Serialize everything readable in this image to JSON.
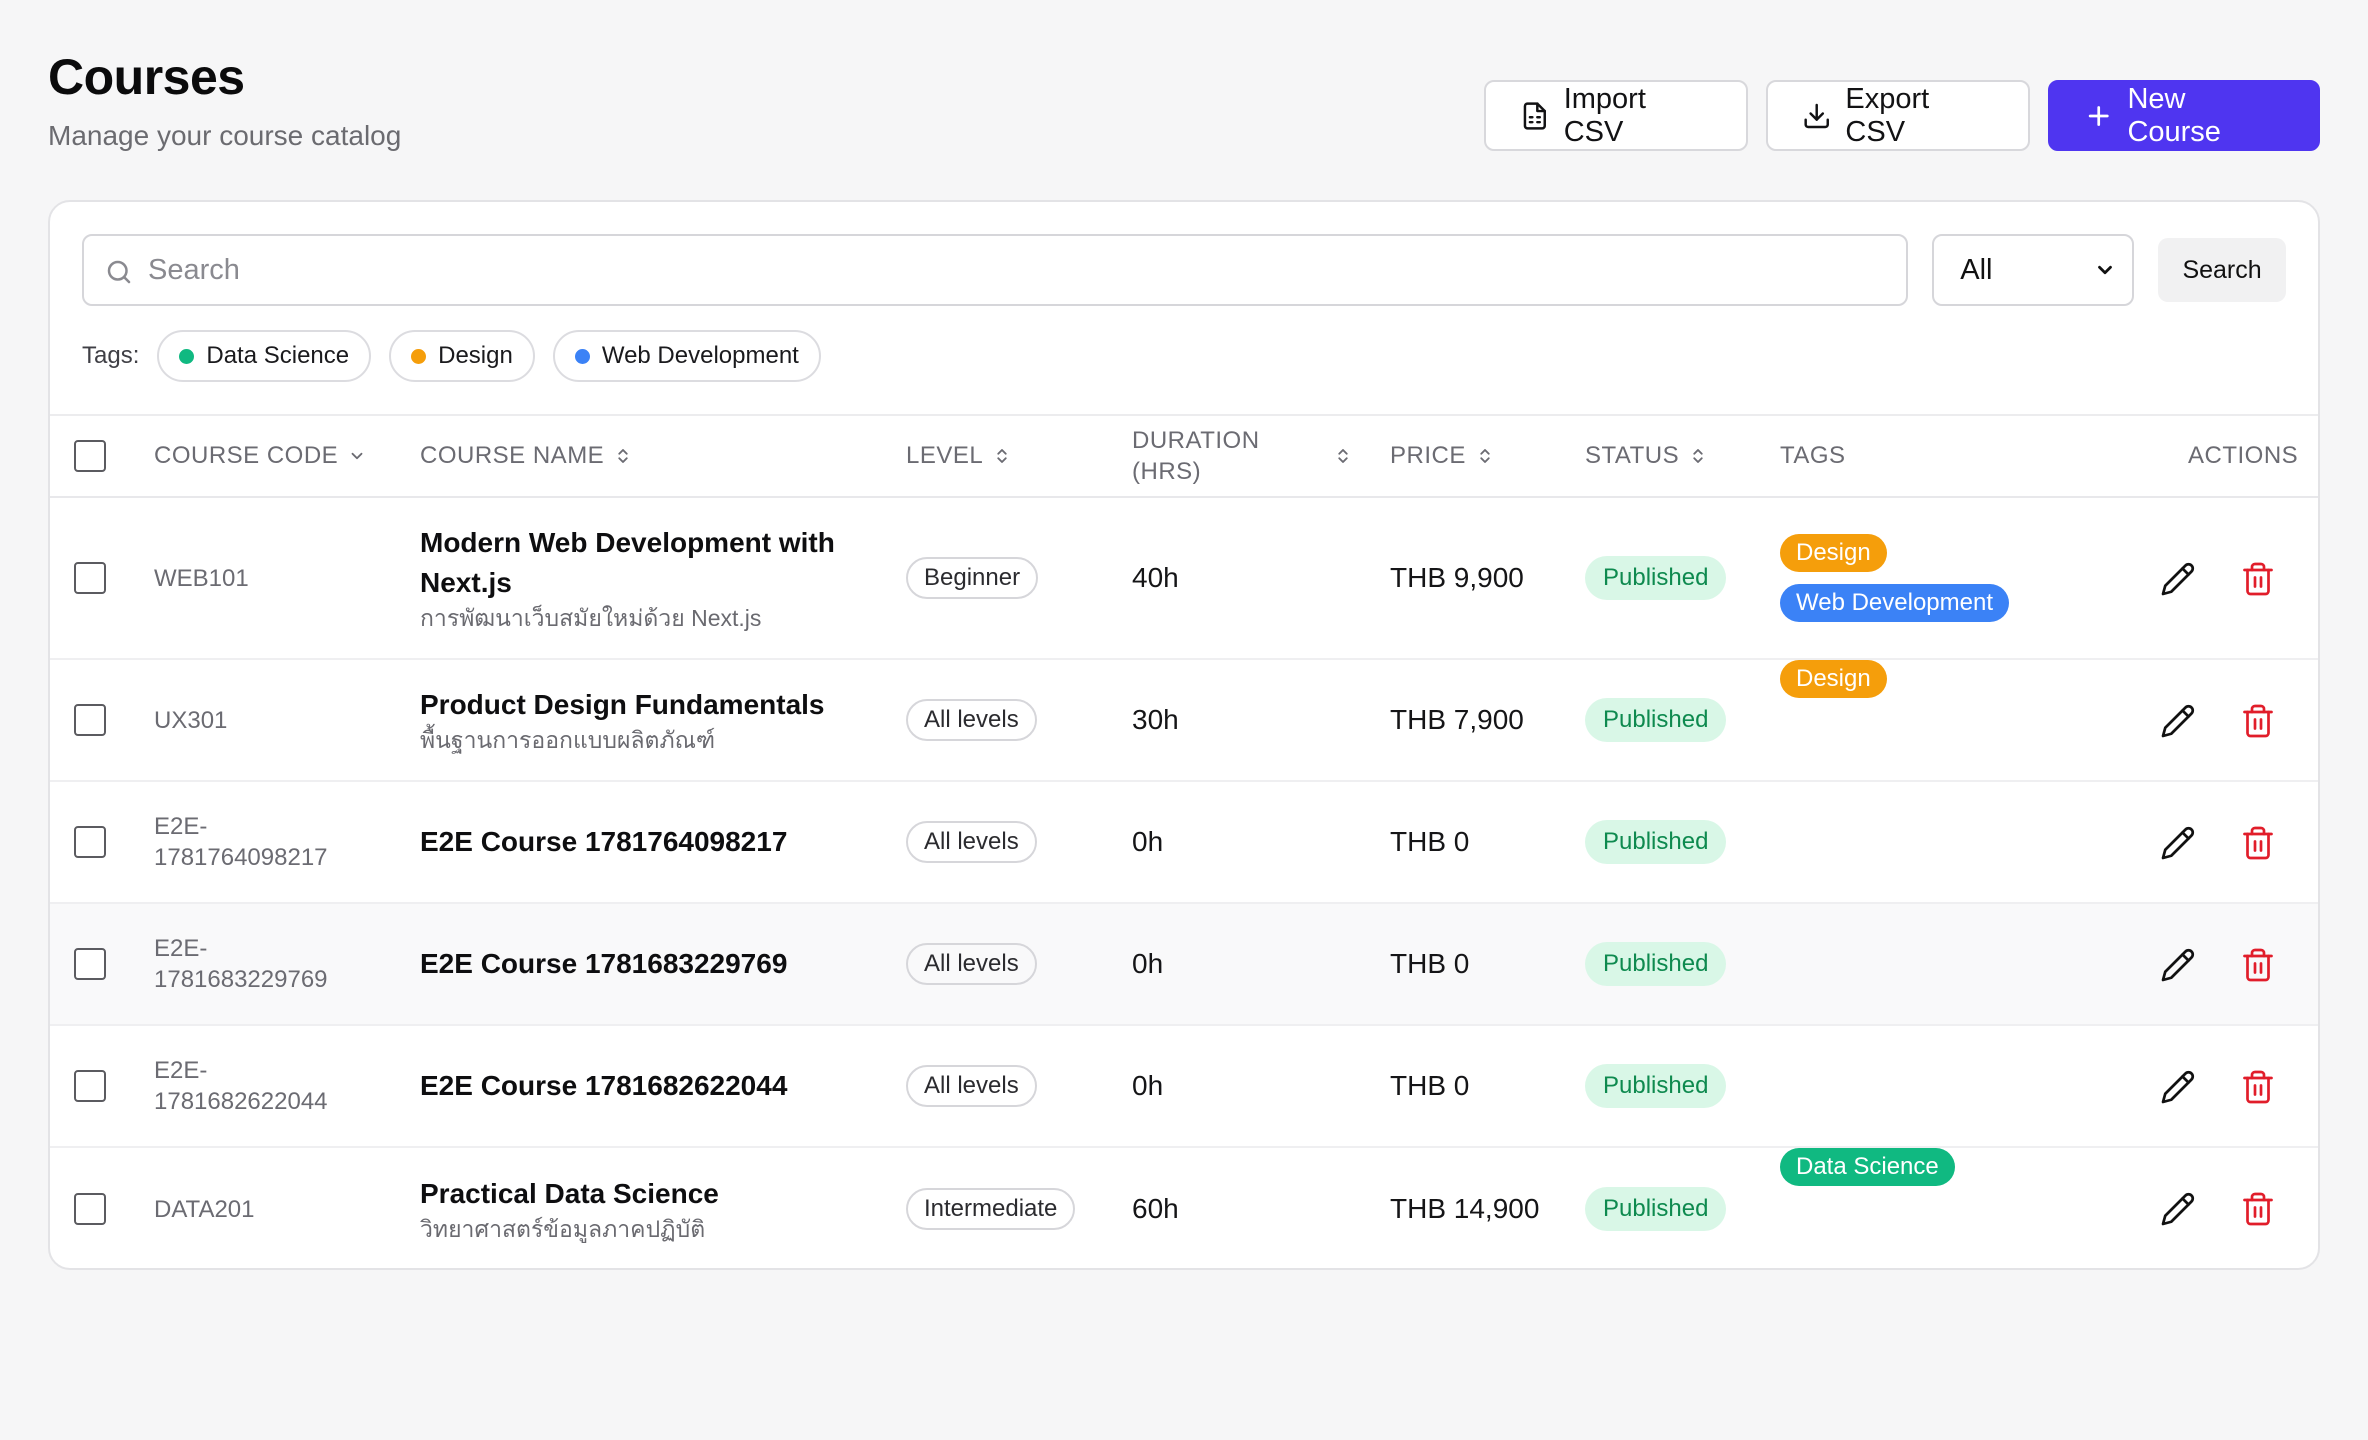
{
  "header": {
    "title": "Courses",
    "subtitle": "Manage your course catalog",
    "import_label": "Import CSV",
    "export_label": "Export CSV",
    "new_label": "New Course"
  },
  "search": {
    "placeholder": "Search",
    "filter_value": "All",
    "button_label": "Search"
  },
  "tags": {
    "label": "Tags:",
    "items": [
      {
        "label": "Data Science",
        "color": "#10b981"
      },
      {
        "label": "Design",
        "color": "#f59e0b"
      },
      {
        "label": "Web Development",
        "color": "#3b82f6"
      }
    ]
  },
  "table": {
    "columns": {
      "code": "COURSE CODE",
      "name": "COURSE NAME",
      "level": "LEVEL",
      "duration_1": "DURATION",
      "duration_2": "(HRS)",
      "price": "PRICE",
      "status": "STATUS",
      "tags": "TAGS",
      "actions": "ACTIONS"
    },
    "rows": [
      {
        "code": "WEB101",
        "name": "Modern Web Development with Next.js",
        "subname": "การพัฒนาเว็บสมัยใหม่ด้วย Next.js",
        "level": "Beginner",
        "duration": "40h",
        "price": "THB 9,900",
        "status": "Published",
        "tags": [
          {
            "label": "Design",
            "color": "#f59e0b"
          },
          {
            "label": "Web Development",
            "color": "#3b82f6"
          }
        ]
      },
      {
        "code": "UX301",
        "name": "Product Design Fundamentals",
        "subname": "พื้นฐานการออกแบบผลิตภัณฑ์",
        "level": "All levels",
        "duration": "30h",
        "price": "THB 7,900",
        "status": "Published",
        "tags": [
          {
            "label": "Design",
            "color": "#f59e0b"
          }
        ]
      },
      {
        "code": "E2E-1781764098217",
        "name": "E2E Course 1781764098217",
        "subname": "",
        "level": "All levels",
        "duration": "0h",
        "price": "THB 0",
        "status": "Published",
        "tags": []
      },
      {
        "code": "E2E-1781683229769",
        "name": "E2E Course 1781683229769",
        "subname": "",
        "level": "All levels",
        "duration": "0h",
        "price": "THB 0",
        "status": "Published",
        "tags": []
      },
      {
        "code": "E2E-1781682622044",
        "name": "E2E Course 1781682622044",
        "subname": "",
        "level": "All levels",
        "duration": "0h",
        "price": "THB 0",
        "status": "Published",
        "tags": []
      },
      {
        "code": "DATA201",
        "name": "Practical Data Science",
        "subname": "วิทยาศาสตร์ข้อมูลภาคปฏิบัติ",
        "level": "Intermediate",
        "duration": "60h",
        "price": "THB 14,900",
        "status": "Published",
        "tags": [
          {
            "label": "Data Science",
            "color": "#10b981"
          }
        ]
      }
    ]
  },
  "colors": {
    "primary": "#4f35f0",
    "status_bg": "#d9f7e7",
    "status_text": "#0e8a4f",
    "delete": "#e11d2a"
  }
}
